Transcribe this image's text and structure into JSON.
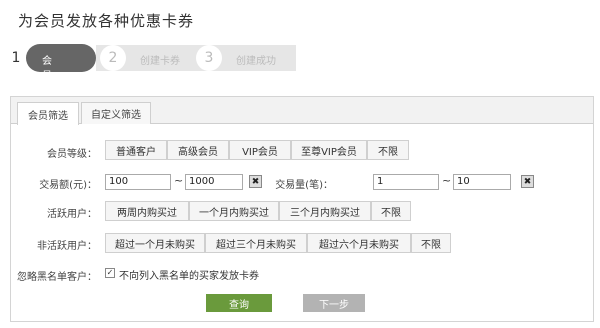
{
  "page": {
    "title": "为会员发放各种优惠卡券"
  },
  "stepper": {
    "steps": [
      {
        "number": "1",
        "label": "会员筛选"
      },
      {
        "number": "2",
        "label": "创建卡券"
      },
      {
        "number": "3",
        "label": "创建成功"
      }
    ]
  },
  "tabs": [
    {
      "label": "会员筛选"
    },
    {
      "label": "自定义筛选"
    }
  ],
  "form": {
    "level": {
      "label": "会员等级：",
      "options": [
        "普通客户",
        "高级会员",
        "VIP会员",
        "至尊VIP会员",
        "不限"
      ]
    },
    "amount": {
      "label": "交易额(元)：",
      "min": "100",
      "max": "1000",
      "clear_glyph": "✖"
    },
    "count": {
      "label": "交易量(笔)：",
      "min": "1",
      "max": "10",
      "clear_glyph": "✖"
    },
    "range_sep": "~",
    "active": {
      "label": "活跃用户：",
      "options": [
        "两周内购买过",
        "一个月内购买过",
        "三个月内购买过",
        "不限"
      ]
    },
    "inactive": {
      "label": "非活跃用户：",
      "options": [
        "超过一个月未购买",
        "超过三个月未购买",
        "超过六个月未购买",
        "不限"
      ]
    },
    "blacklist": {
      "label": "忽略黑名单客户：",
      "checkbox_label": "不向列入黑名单的买家发放卡券",
      "checked": true
    }
  },
  "actions": {
    "search": "查询",
    "next": "下一步"
  }
}
